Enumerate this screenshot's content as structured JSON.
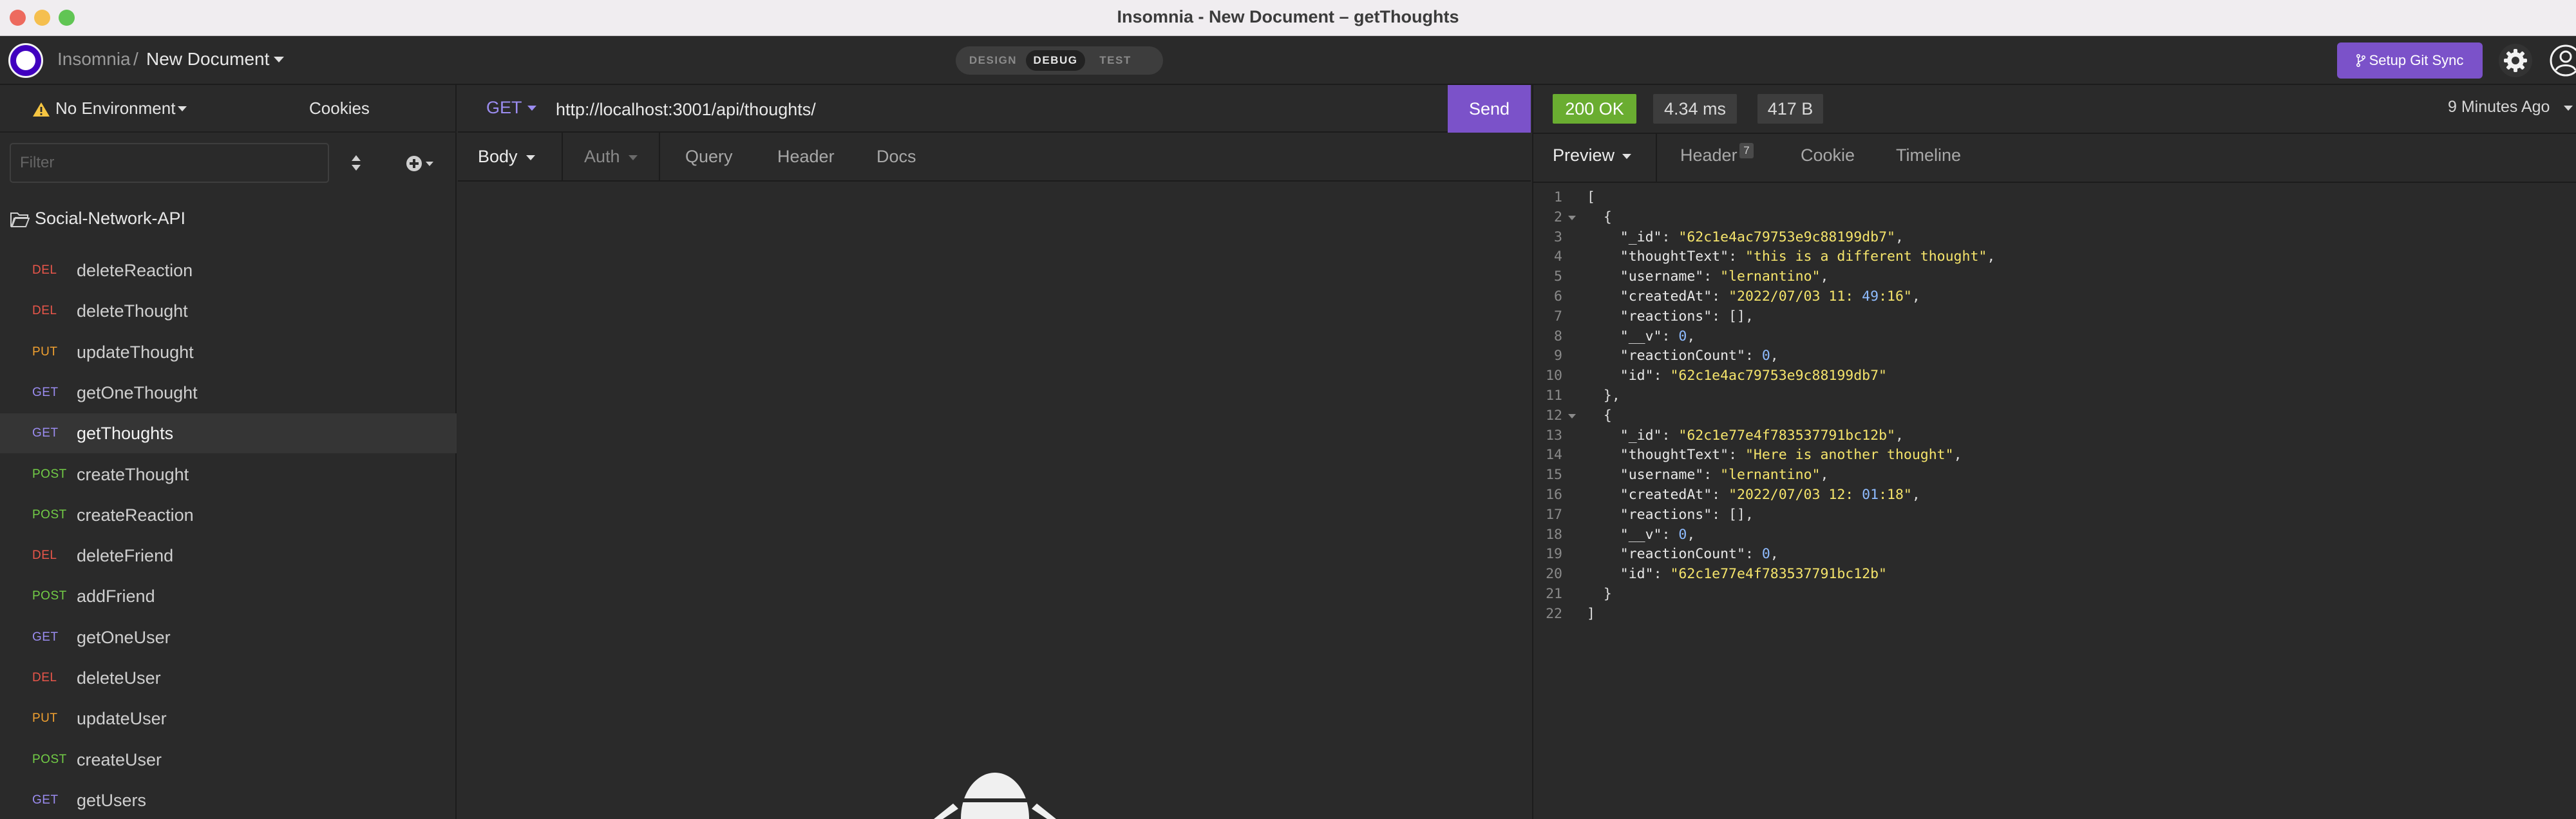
{
  "window": {
    "title": "Insomnia - New Document – getThoughts"
  },
  "header": {
    "app_name": "Insomnia",
    "separator": "/",
    "document_name": "New Document",
    "modes": [
      "DESIGN",
      "DEBUG",
      "TEST"
    ],
    "active_mode": "DEBUG",
    "git_sync_label": "Setup Git Sync"
  },
  "sidebar": {
    "environment_label": "No Environment",
    "cookies_label": "Cookies",
    "filter_placeholder": "Filter",
    "folder_name": "Social-Network-API",
    "requests": [
      {
        "method": "DEL",
        "name": "deleteReaction"
      },
      {
        "method": "DEL",
        "name": "deleteThought"
      },
      {
        "method": "PUT",
        "name": "updateThought"
      },
      {
        "method": "GET",
        "name": "getOneThought"
      },
      {
        "method": "GET",
        "name": "getThoughts",
        "active": true
      },
      {
        "method": "POST",
        "name": "createThought"
      },
      {
        "method": "POST",
        "name": "createReaction"
      },
      {
        "method": "DEL",
        "name": "deleteFriend"
      },
      {
        "method": "POST",
        "name": "addFriend"
      },
      {
        "method": "GET",
        "name": "getOneUser"
      },
      {
        "method": "DEL",
        "name": "deleteUser"
      },
      {
        "method": "PUT",
        "name": "updateUser"
      },
      {
        "method": "POST",
        "name": "createUser"
      },
      {
        "method": "GET",
        "name": "getUsers"
      }
    ]
  },
  "request": {
    "method": "GET",
    "url": "http://localhost:3001/api/thoughts/",
    "send_label": "Send",
    "tabs": {
      "body": "Body",
      "auth": "Auth",
      "query": "Query",
      "header": "Header",
      "docs": "Docs"
    }
  },
  "response": {
    "status": "200 OK",
    "time": "4.34 ms",
    "size": "417 B",
    "received_ago": "9 Minutes Ago",
    "tabs": {
      "preview": "Preview",
      "header": "Header",
      "header_count": "7",
      "cookie": "Cookie",
      "timeline": "Timeline"
    },
    "lines": [
      "[",
      "  {",
      "    \"_id\": \"62c1e4ac79753e9c88199db7\",",
      "    \"thoughtText\": \"this is a different thought\",",
      "    \"username\": \"lernantino\",",
      "    \"createdAt\": \"2022/07/03 11:49:16\",",
      "    \"reactions\": [],",
      "    \"__v\": 0,",
      "    \"reactionCount\": 0,",
      "    \"id\": \"62c1e4ac79753e9c88199db7\"",
      "  },",
      "  {",
      "    \"_id\": \"62c1e77e4f783537791bc12b\",",
      "    \"thoughtText\": \"Here is another thought\",",
      "    \"username\": \"lernantino\",",
      "    \"createdAt\": \"2022/07/03 12:01:18\",",
      "    \"reactions\": [],",
      "    \"__v\": 0,",
      "    \"reactionCount\": 0,",
      "    \"id\": \"62c1e77e4f783537791bc12b\"",
      "  }",
      "]"
    ]
  },
  "colors": {
    "accent": "#7b52c9",
    "status_ok": "#6aad31",
    "method_get": "#9b8cf0",
    "method_post": "#72cc46",
    "method_put": "#f0a030",
    "method_del": "#e8564a",
    "json_string": "#f5e46b",
    "json_number": "#8fbcff"
  },
  "icons": [
    "warning-icon",
    "sort-icon",
    "add-circle-icon",
    "folder-open-icon",
    "git-branch-icon",
    "gear-icon",
    "user-icon",
    "ghost-icon"
  ]
}
